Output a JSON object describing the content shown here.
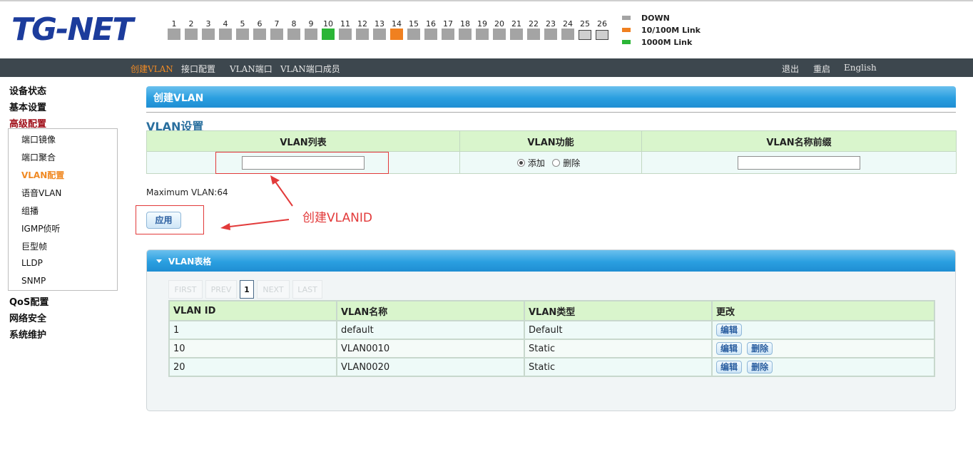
{
  "brand": {
    "logo": "TG-NET"
  },
  "ports": [
    {
      "n": "1",
      "s": "down"
    },
    {
      "n": "2",
      "s": "down"
    },
    {
      "n": "3",
      "s": "down"
    },
    {
      "n": "4",
      "s": "down"
    },
    {
      "n": "5",
      "s": "down"
    },
    {
      "n": "6",
      "s": "down"
    },
    {
      "n": "7",
      "s": "down"
    },
    {
      "n": "8",
      "s": "down"
    },
    {
      "n": "9",
      "s": "down"
    },
    {
      "n": "10",
      "s": "link1000"
    },
    {
      "n": "11",
      "s": "down"
    },
    {
      "n": "12",
      "s": "down"
    },
    {
      "n": "13",
      "s": "down"
    },
    {
      "n": "14",
      "s": "link100"
    },
    {
      "n": "15",
      "s": "down"
    },
    {
      "n": "16",
      "s": "down"
    },
    {
      "n": "17",
      "s": "down"
    },
    {
      "n": "18",
      "s": "down"
    },
    {
      "n": "19",
      "s": "down"
    },
    {
      "n": "20",
      "s": "down"
    },
    {
      "n": "21",
      "s": "down"
    },
    {
      "n": "22",
      "s": "down"
    },
    {
      "n": "23",
      "s": "down"
    },
    {
      "n": "24",
      "s": "down"
    },
    {
      "n": "25",
      "s": "sfp"
    },
    {
      "n": "26",
      "s": "sfp"
    }
  ],
  "legend": [
    {
      "label": "DOWN",
      "color": "#a4a4a4"
    },
    {
      "label": "10/100M Link",
      "color": "#f08020"
    },
    {
      "label": "1000M Link",
      "color": "#2bb536"
    }
  ],
  "topnav": {
    "left": [
      "创建VLAN",
      "接口配置",
      "VLAN端口",
      "VLAN端口成员"
    ],
    "right": [
      "退出",
      "重启",
      "English"
    ]
  },
  "sidebar": {
    "top": [
      "设备状态",
      "基本设置",
      "高级配置"
    ],
    "submenu": [
      "端口镜像",
      "端口聚合",
      "VLAN配置",
      "语音VLAN",
      "组播",
      "IGMP侦听",
      "巨型帧",
      "LLDP",
      "SNMP"
    ],
    "bottom": [
      "QoS配置",
      "网络安全",
      "系统维护"
    ]
  },
  "page": {
    "title": "创建VLAN",
    "section": "VLAN设置"
  },
  "form": {
    "col_list": "VLAN列表",
    "col_func": "VLAN功能",
    "col_prefix": "VLAN名称前缀",
    "radio_add": "添加",
    "radio_del": "删除",
    "list_value": "",
    "prefix_value": ""
  },
  "max_vlan": "Maximum VLAN:64",
  "apply_label": "应用",
  "annotation": "创建VLANID",
  "table_panel": {
    "title": "VLAN表格",
    "pager": [
      "FIRST",
      "PREV",
      "1",
      "NEXT",
      "LAST"
    ],
    "headers": [
      "VLAN ID",
      "VLAN名称",
      "VLAN类型",
      "更改"
    ],
    "rows": [
      {
        "id": "1",
        "name": "default",
        "type": "Default",
        "actions": [
          "编辑"
        ]
      },
      {
        "id": "10",
        "name": "VLAN0010",
        "type": "Static",
        "actions": [
          "编辑",
          "删除"
        ]
      },
      {
        "id": "20",
        "name": "VLAN0020",
        "type": "Static",
        "actions": [
          "编辑",
          "删除"
        ]
      }
    ]
  }
}
